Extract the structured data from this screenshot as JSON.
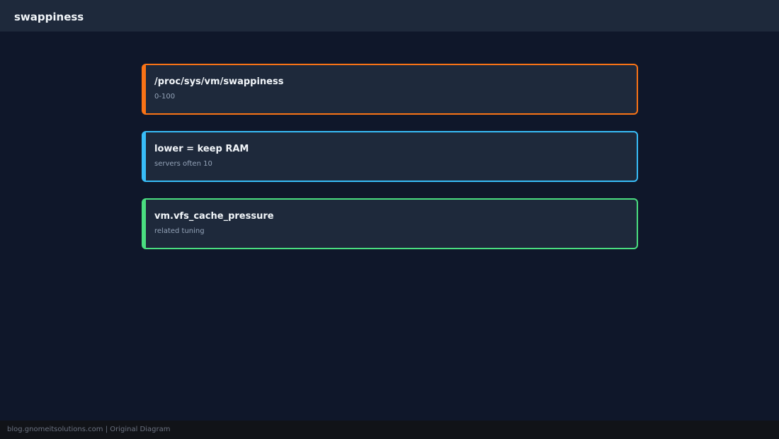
{
  "header": {
    "title": "swappiness"
  },
  "cards": [
    {
      "title": "/proc/sys/vm/swappiness",
      "subtitle": "0-100",
      "accent": "#f97316"
    },
    {
      "title": "lower = keep RAM",
      "subtitle": "servers often 10",
      "accent": "#38bdf8"
    },
    {
      "title": "vm.vfs_cache_pressure",
      "subtitle": "related tuning",
      "accent": "#4ade80"
    }
  ],
  "footer": {
    "text": "blog.gnomeitsolutions.com | Original Diagram"
  },
  "colors": {
    "background": "#0f172a",
    "header": "#1e293b",
    "card": "#1e293b"
  }
}
